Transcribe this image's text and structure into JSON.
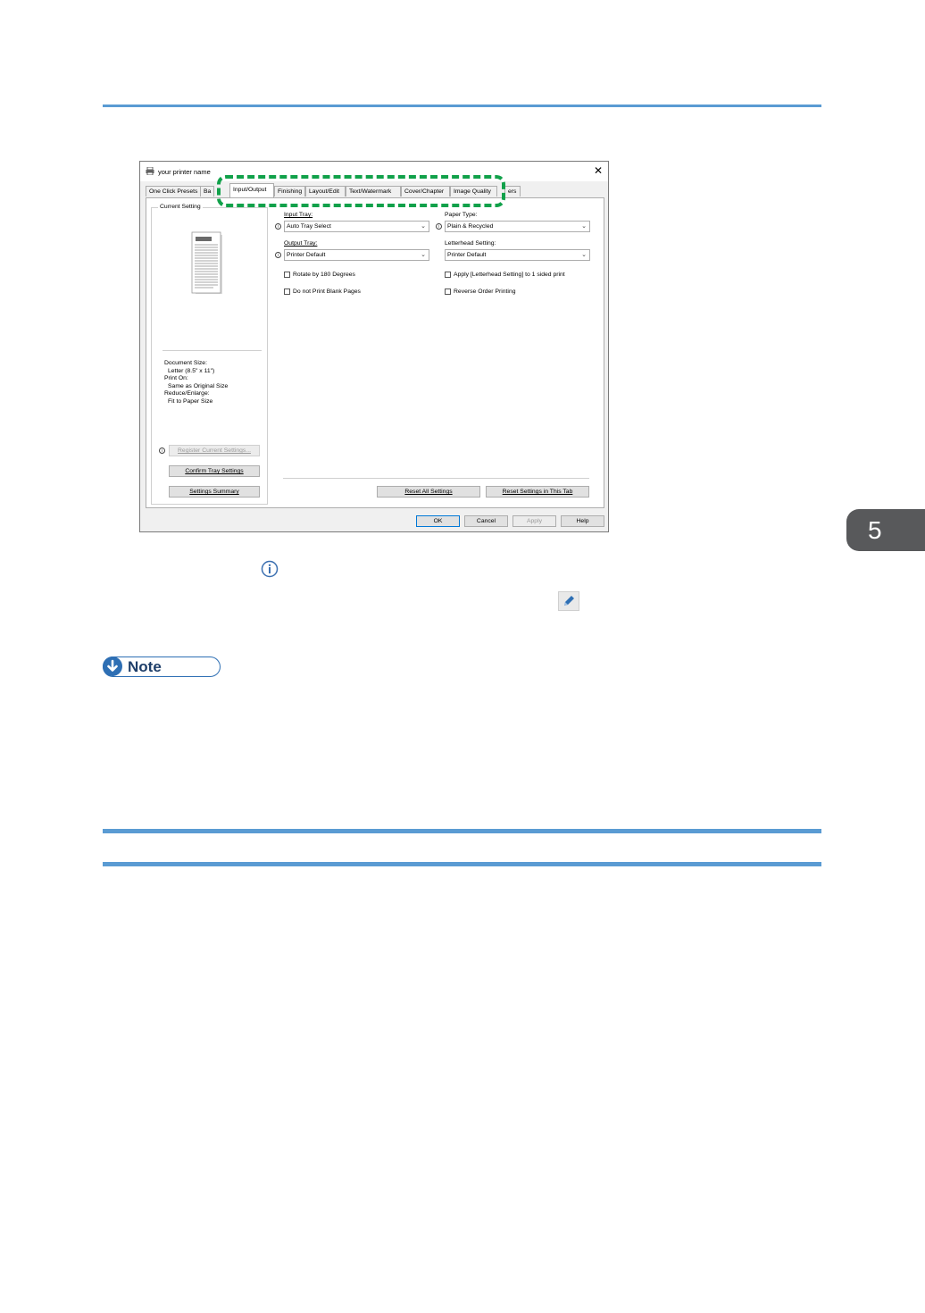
{
  "page": {
    "chapter_number": "5",
    "rule_color": "#5a9bd3",
    "highlight_color": "#11a14a"
  },
  "dialog": {
    "title": "your printer name",
    "close_glyph": "✕",
    "tabs": [
      "One Click Presets",
      "Ba",
      "Input/Output",
      "Finishing",
      "Layout/Edit",
      "Text/Watermark",
      "Cover/Chapter",
      "Image Quality",
      "ers"
    ],
    "active_tab": "Input/Output",
    "current_setting": {
      "label": "Current Setting",
      "document_size_label": "Document Size:",
      "document_size_value": "Letter (8.5\" x 11\")",
      "print_on_label": "Print On:",
      "print_on_value": "Same as Original Size",
      "reduce_enlarge_label": "Reduce/Enlarge:",
      "reduce_enlarge_value": "Fit to Paper Size",
      "register_button": "Register Current Settings...",
      "confirm_tray_button": "Confirm Tray Settings",
      "settings_summary_button": "Settings Summary"
    },
    "fields": {
      "input_tray_label": "Input Tray:",
      "input_tray_value": "Auto Tray Select",
      "paper_type_label": "Paper Type:",
      "paper_type_value": "Plain & Recycled",
      "output_tray_label": "Output Tray:",
      "output_tray_value": "Printer Default",
      "letterhead_label": "Letterhead Setting:",
      "letterhead_value": "Printer Default"
    },
    "checkboxes": {
      "rotate": "Rotate by 180 Degrees",
      "apply_letterhead": "Apply [Letterhead Setting] to 1 sided print",
      "no_blank": "Do not Print Blank Pages",
      "reverse_order": "Reverse Order Printing"
    },
    "buttons": {
      "reset_all": "Reset All Settings",
      "reset_tab": "Reset Settings in This Tab",
      "ok": "OK",
      "cancel": "Cancel",
      "apply": "Apply",
      "help": "Help"
    }
  },
  "note": {
    "label": "Note"
  },
  "icons": {
    "info": "info-icon",
    "edit": "pencil-icon",
    "printer": "printer-icon",
    "note_arrow": "arrow-down-icon"
  }
}
